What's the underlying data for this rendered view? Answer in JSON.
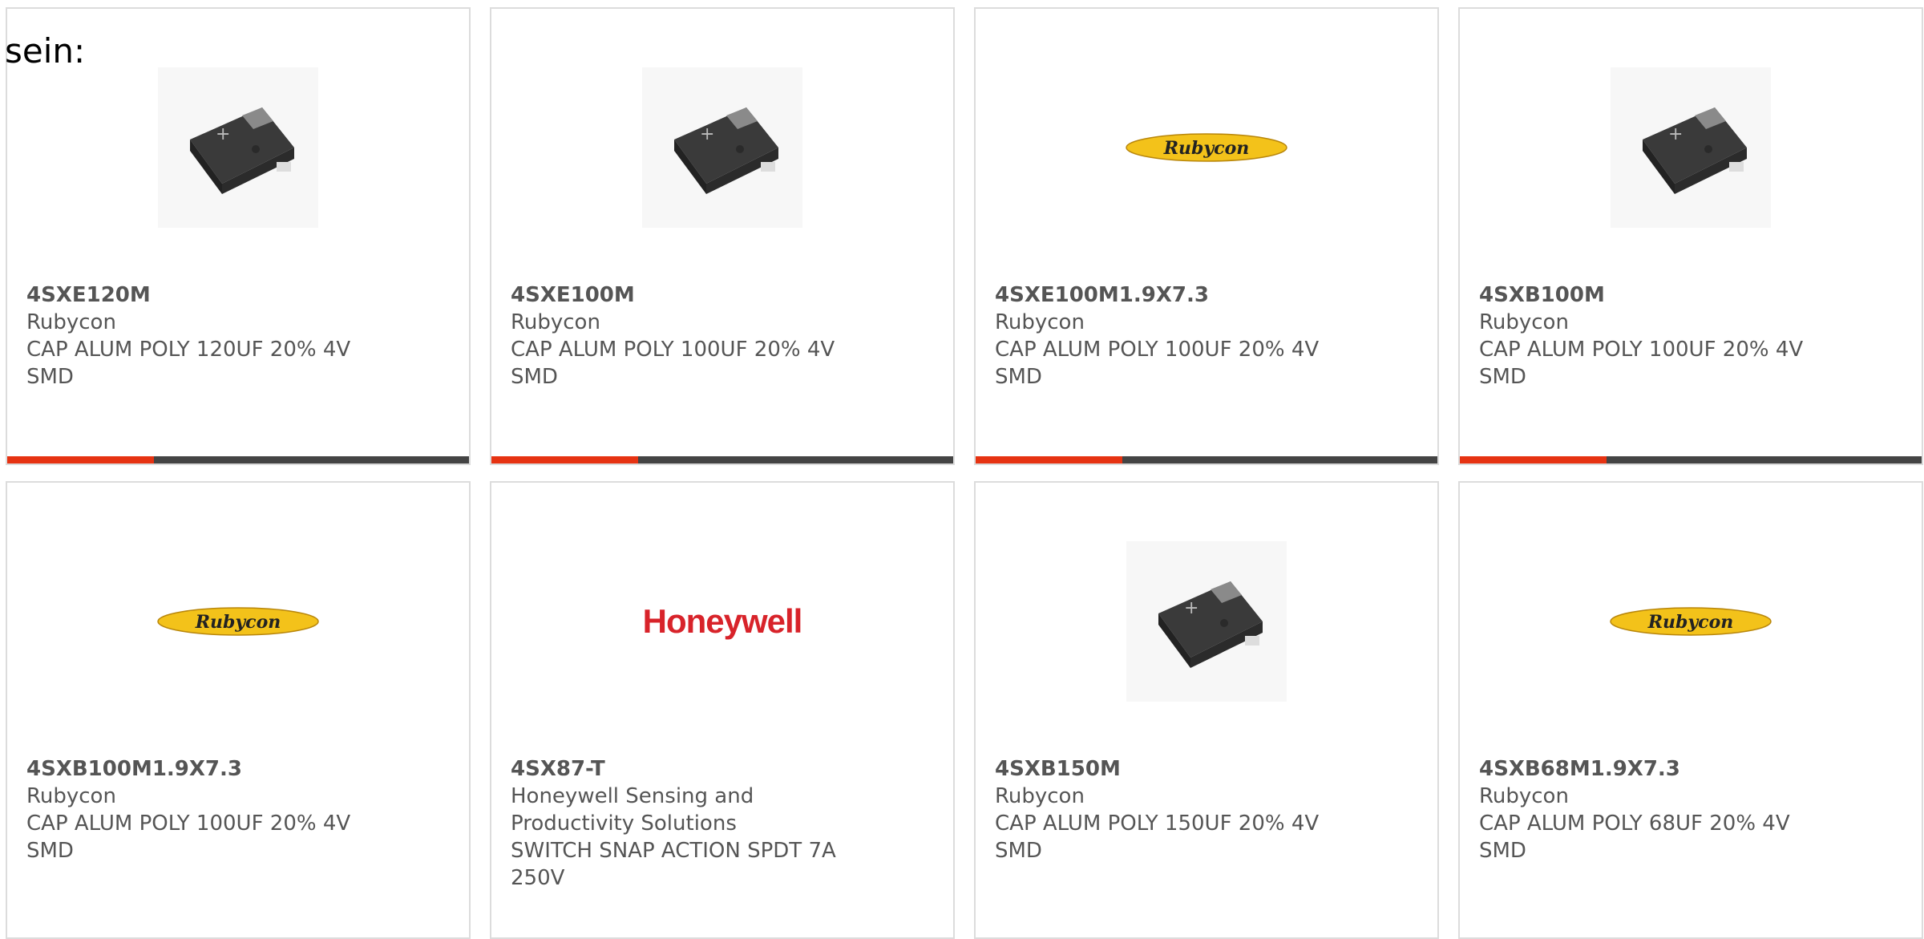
{
  "intro_text": "sein:",
  "accent_color": "#e63312",
  "bar_color": "#444444",
  "products": [
    {
      "part_number": "4SXE120M",
      "manufacturer": "Rubycon",
      "description": "CAP ALUM POLY 120UF 20% 4V SMD",
      "image": "capacitor-photo"
    },
    {
      "part_number": "4SXE100M",
      "manufacturer": "Rubycon",
      "description": "CAP ALUM POLY 100UF 20% 4V SMD",
      "image": "capacitor-photo"
    },
    {
      "part_number": "4SXE100M1.9X7.3",
      "manufacturer": "Rubycon",
      "description": "CAP ALUM POLY 100UF 20% 4V SMD",
      "image": "rubycon-logo",
      "logo_text": "Rubycon"
    },
    {
      "part_number": "4SXB100M",
      "manufacturer": "Rubycon",
      "description": "CAP ALUM POLY 100UF 20% 4V SMD",
      "image": "capacitor-photo"
    },
    {
      "part_number": "4SXB100M1.9X7.3",
      "manufacturer": "Rubycon",
      "description": "CAP ALUM POLY 100UF 20% 4V SMD",
      "image": "rubycon-logo",
      "logo_text": "Rubycon"
    },
    {
      "part_number": "4SX87-T",
      "manufacturer": "Honeywell Sensing and Productivity Solutions",
      "description": "SWITCH SNAP ACTION SPDT 7A 250V",
      "image": "honeywell-logo",
      "logo_text": "Honeywell"
    },
    {
      "part_number": "4SXB150M",
      "manufacturer": "Rubycon",
      "description": "CAP ALUM POLY 150UF 20% 4V SMD",
      "image": "capacitor-photo"
    },
    {
      "part_number": "4SXB68M1.9X7.3",
      "manufacturer": "Rubycon",
      "description": "CAP ALUM POLY 68UF 20% 4V SMD",
      "image": "rubycon-logo",
      "logo_text": "Rubycon"
    }
  ]
}
